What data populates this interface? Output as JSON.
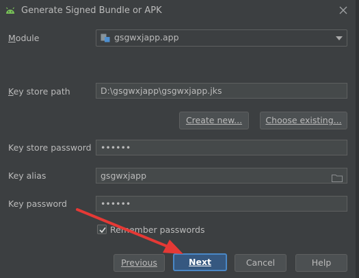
{
  "window": {
    "title": "Generate Signed Bundle or APK"
  },
  "module": {
    "label": "Module",
    "value": "gsgwxjapp.app"
  },
  "keystore": {
    "path_label": "Key store path",
    "path_value": "D:\\gsgwxjapp\\gsgwxjapp.jks",
    "create_label": "Create new...",
    "choose_label": "Choose existing...",
    "password_label": "Key store password",
    "password_value": "••••••"
  },
  "key": {
    "alias_label": "Key alias",
    "alias_value": "gsgwxjapp",
    "password_label": "Key password",
    "password_value": "••••••"
  },
  "remember": {
    "label": "Remember passwords",
    "checked": true
  },
  "footer": {
    "previous": "Previous",
    "next": "Next",
    "cancel": "Cancel",
    "help": "Help"
  },
  "colors": {
    "background": "#3c3f41",
    "field": "#45494a",
    "default_button": "#365880",
    "annotation_arrow": "#e53935"
  }
}
